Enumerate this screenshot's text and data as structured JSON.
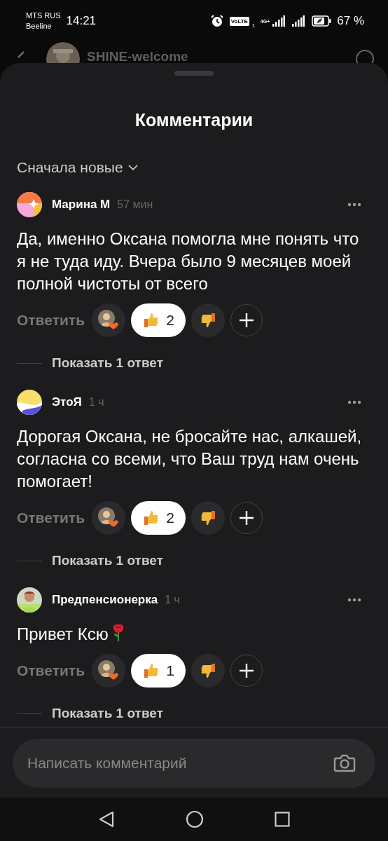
{
  "status_bar": {
    "carrier_1": "MTS RUS",
    "carrier_2": "Beeline",
    "time": "14:21",
    "volte": "VoLTE",
    "sim_index": "1",
    "network": "4G+",
    "battery": "67 %"
  },
  "background_header": {
    "title": "SHINE-welcome"
  },
  "sheet": {
    "title": "Комментарии",
    "sort": {
      "label": "Сначала новые"
    },
    "comments": [
      {
        "author": "Марина М",
        "time": "57 мин",
        "avatar": {
          "kind": "sparkle"
        },
        "text": "Да, именно Оксана помогла мне понять что я не туда иду. Вчера было 9 месяцев моей полной чистоты от всего",
        "has_rose": false,
        "reply_label": "Ответить",
        "reactions": [
          {
            "kind": "author_heart",
            "selected": false
          },
          {
            "kind": "like",
            "count": "2",
            "selected": true
          },
          {
            "kind": "dislike",
            "selected": false
          },
          {
            "kind": "add",
            "selected": false
          }
        ],
        "show_replies": "Показать 1 ответ"
      },
      {
        "author": "ЭтоЯ",
        "time": "1 ч",
        "avatar": {
          "kind": "wave"
        },
        "text": "Дорогая Оксана, не бросайте нас, алкашей, согласна со всеми, что Ваш труд нам очень помогает!",
        "has_rose": false,
        "reply_label": "Ответить",
        "reactions": [
          {
            "kind": "author_heart",
            "selected": false
          },
          {
            "kind": "like",
            "count": "2",
            "selected": true
          },
          {
            "kind": "dislike",
            "selected": false
          },
          {
            "kind": "add",
            "selected": false
          }
        ],
        "show_replies": "Показать 1 ответ"
      },
      {
        "author": "Предпенсионерка",
        "time": "1 ч",
        "text": "Привет Ксю",
        "has_rose": true,
        "reply_label": "Ответить",
        "reactions": [
          {
            "kind": "author_heart",
            "selected": false
          },
          {
            "kind": "like",
            "count": "1",
            "selected": true
          },
          {
            "kind": "dislike",
            "selected": false
          },
          {
            "kind": "add",
            "selected": false
          }
        ],
        "show_replies": "Показать 1 ответ"
      }
    ]
  },
  "comment_input": {
    "placeholder": "Написать комментарий"
  }
}
